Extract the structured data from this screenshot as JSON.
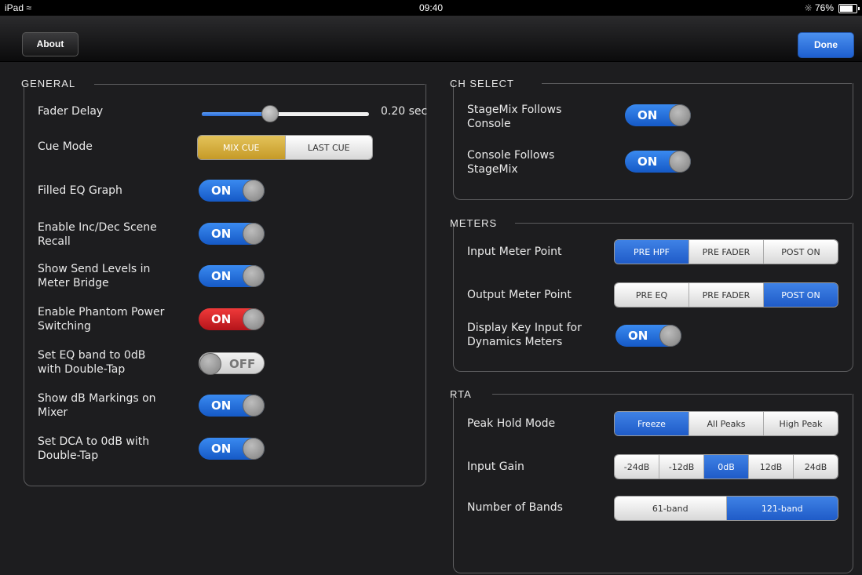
{
  "status": {
    "device": "iPad",
    "wifi_icon": "wifi-icon",
    "time": "09:40",
    "bluetooth_icon": "bluetooth-icon",
    "battery": "76%",
    "battery_level": 0.76
  },
  "nav": {
    "about": "About",
    "done": "Done"
  },
  "general": {
    "title": "GENERAL",
    "fader_delay": {
      "label": "Fader Delay",
      "value": "0.20 sec",
      "level": 0.41
    },
    "cue_mode": {
      "label": "Cue Mode",
      "options": [
        "MIX CUE",
        "LAST CUE"
      ],
      "selected": "MIX CUE"
    },
    "filled_eq": {
      "label": "Filled EQ Graph",
      "state": "ON"
    },
    "inc_dec": {
      "label_1": "Enable Inc/Dec Scene",
      "label_2": "Recall",
      "state": "ON"
    },
    "send_levels": {
      "label_1": "Show Send Levels in",
      "label_2": "Meter Bridge",
      "state": "ON"
    },
    "phantom": {
      "label_1": "Enable Phantom Power",
      "label_2": "Switching",
      "state": "ON",
      "color": "#d42a2a"
    },
    "eq_band": {
      "label_1": "Set EQ band to 0dB",
      "label_2": "with Double-Tap",
      "state": "OFF"
    },
    "db_markings": {
      "label_1": "Show dB Markings on",
      "label_2": "Mixer",
      "state": "ON"
    },
    "dca": {
      "label_1": "Set DCA to 0dB with",
      "label_2": "Double-Tap",
      "state": "ON"
    }
  },
  "ch_select": {
    "title": "CH SELECT",
    "stagemix_follows": {
      "label_1": "StageMix Follows",
      "label_2": "Console",
      "state": "ON"
    },
    "console_follows": {
      "label_1": "Console Follows",
      "label_2": "StageMix",
      "state": "ON"
    }
  },
  "meters": {
    "title": "METERS",
    "input_point": {
      "label": "Input Meter Point",
      "options": [
        "PRE HPF",
        "PRE FADER",
        "POST ON"
      ],
      "selected": "PRE HPF"
    },
    "output_point": {
      "label": "Output Meter Point",
      "options": [
        "PRE EQ",
        "PRE FADER",
        "POST ON"
      ],
      "selected": "POST ON"
    },
    "key_input": {
      "label_1": "Display Key Input for",
      "label_2": "Dynamics Meters",
      "state": "ON"
    }
  },
  "rta": {
    "title": "RTA",
    "peak_hold": {
      "label": "Peak Hold Mode",
      "options": [
        "Freeze",
        "All Peaks",
        "High Peak"
      ],
      "selected": "Freeze"
    },
    "input_gain": {
      "label": "Input Gain",
      "options": [
        "-24dB",
        "-12dB",
        "0dB",
        "12dB",
        "24dB"
      ],
      "selected": "0dB"
    },
    "bands": {
      "label": "Number of Bands",
      "options": [
        "61-band",
        "121-band"
      ],
      "selected": "121-band"
    }
  },
  "colors": {
    "accent": "#2a6bd6",
    "gold": "#d4ae3e",
    "red": "#d42a2a"
  }
}
